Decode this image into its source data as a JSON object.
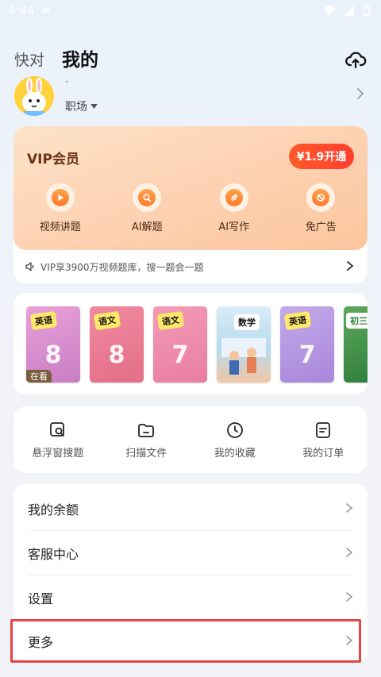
{
  "status_bar": {
    "time": "4:44"
  },
  "header": {
    "tab_inactive": "快对",
    "tab_active": "我的"
  },
  "profile": {
    "name": "·",
    "role": "职场"
  },
  "vip": {
    "title": "VIP会员",
    "open_button": "¥1.9开通",
    "features": [
      {
        "label": "视频讲题",
        "icon": "play-icon"
      },
      {
        "label": "AI解题",
        "icon": "search-icon"
      },
      {
        "label": "AI写作",
        "icon": "leaf-icon"
      },
      {
        "label": "免广告",
        "icon": "no-ads-icon"
      }
    ],
    "promo": "VIP享3900万视频题库，搜一题会一题"
  },
  "books": [
    {
      "subject": "英语",
      "grade": "8",
      "seen": "在看"
    },
    {
      "subject": "语文",
      "grade": "8"
    },
    {
      "subject": "语文",
      "grade": "7"
    },
    {
      "subject": "数学",
      "grade": ""
    },
    {
      "subject": "英语",
      "grade": "7"
    },
    {
      "subject": "初三",
      "grade": ""
    }
  ],
  "tools": [
    {
      "label": "悬浮窗搜题",
      "icon": "float-search-icon"
    },
    {
      "label": "扫描文件",
      "icon": "folder-icon"
    },
    {
      "label": "我的收藏",
      "icon": "clock-icon"
    },
    {
      "label": "我的订单",
      "icon": "order-icon"
    }
  ],
  "menu": {
    "balance": "我的余额",
    "service": "客服中心",
    "settings": "设置",
    "more": "更多"
  },
  "colors": {
    "accent": "#ff4a2c",
    "highlight": "#e44646"
  }
}
